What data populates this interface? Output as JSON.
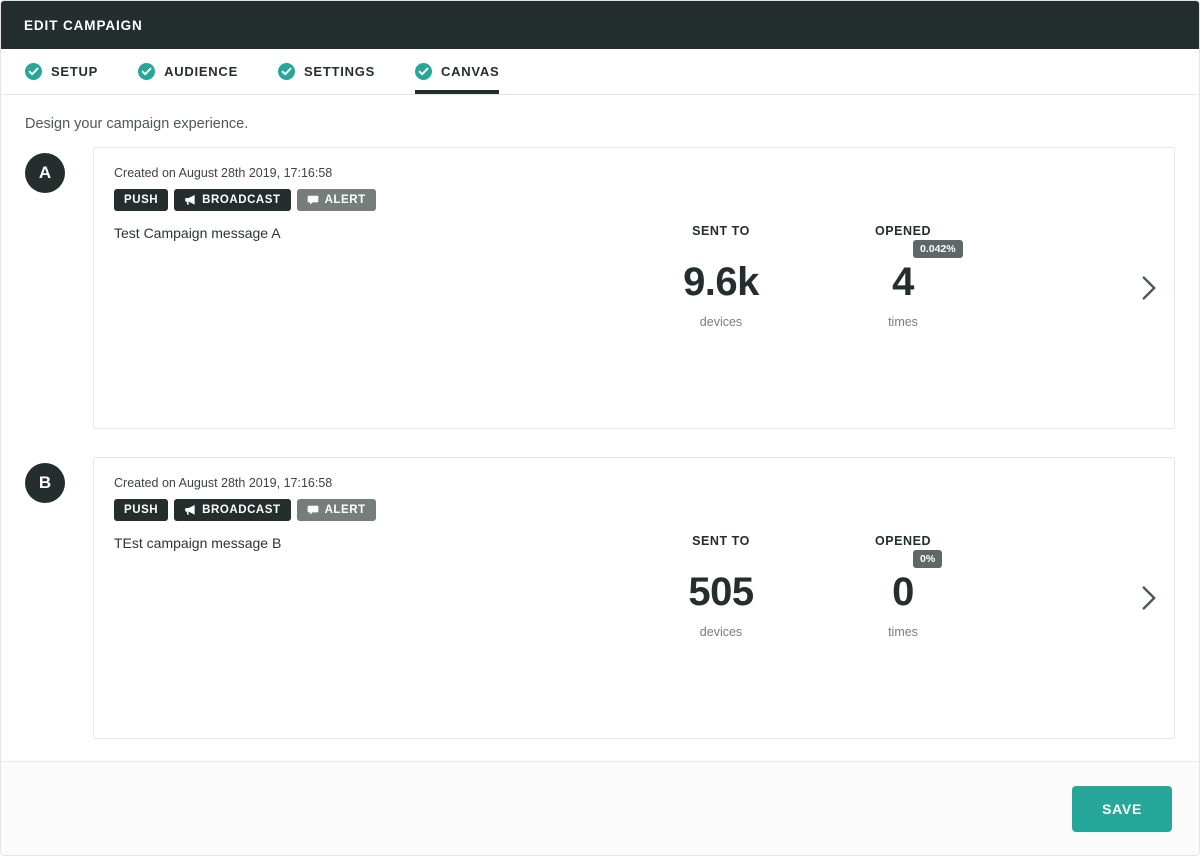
{
  "window": {
    "title": "EDIT CAMPAIGN",
    "header_bg": "#242e2c"
  },
  "tabs": [
    {
      "label": "SETUP",
      "icon": "check-circle-icon",
      "active": false
    },
    {
      "label": "AUDIENCE",
      "icon": "check-circle-icon",
      "active": false
    },
    {
      "label": "SETTINGS",
      "icon": "check-circle-icon",
      "active": false
    },
    {
      "label": "CANVAS",
      "icon": "check-circle-icon",
      "active": true
    }
  ],
  "page": {
    "subtitle": "Design your campaign experience.",
    "accent_color": "#27a79a",
    "dark_color": "#242e2c",
    "gray_badge_color": "#757e7b"
  },
  "variants": [
    {
      "letter": "A",
      "created_on": "Created on August 28th 2019, 17:16:58",
      "badges": [
        {
          "label": "PUSH",
          "icon": null,
          "style": "dark"
        },
        {
          "label": "BROADCAST",
          "icon": "megaphone-icon",
          "style": "dark"
        },
        {
          "label": "ALERT",
          "icon": "comment-icon",
          "style": "gray"
        }
      ],
      "message": "Test Campaign message A",
      "stats": [
        {
          "label": "SENT TO",
          "value": "9.6k",
          "unit": "devices",
          "percent": null
        },
        {
          "label": "OPENED",
          "value": "4",
          "unit": "times",
          "percent": "0.042%"
        }
      ],
      "chevron": "chevron-right-icon"
    },
    {
      "letter": "B",
      "created_on": "Created on August 28th 2019, 17:16:58",
      "badges": [
        {
          "label": "PUSH",
          "icon": null,
          "style": "dark"
        },
        {
          "label": "BROADCAST",
          "icon": "megaphone-icon",
          "style": "dark"
        },
        {
          "label": "ALERT",
          "icon": "comment-icon",
          "style": "gray"
        }
      ],
      "message": "TEst campaign message B",
      "stats": [
        {
          "label": "SENT TO",
          "value": "505",
          "unit": "devices",
          "percent": null
        },
        {
          "label": "OPENED",
          "value": "0",
          "unit": "times",
          "percent": "0%"
        }
      ],
      "chevron": "chevron-right-icon"
    }
  ],
  "footer": {
    "save_label": "SAVE"
  }
}
